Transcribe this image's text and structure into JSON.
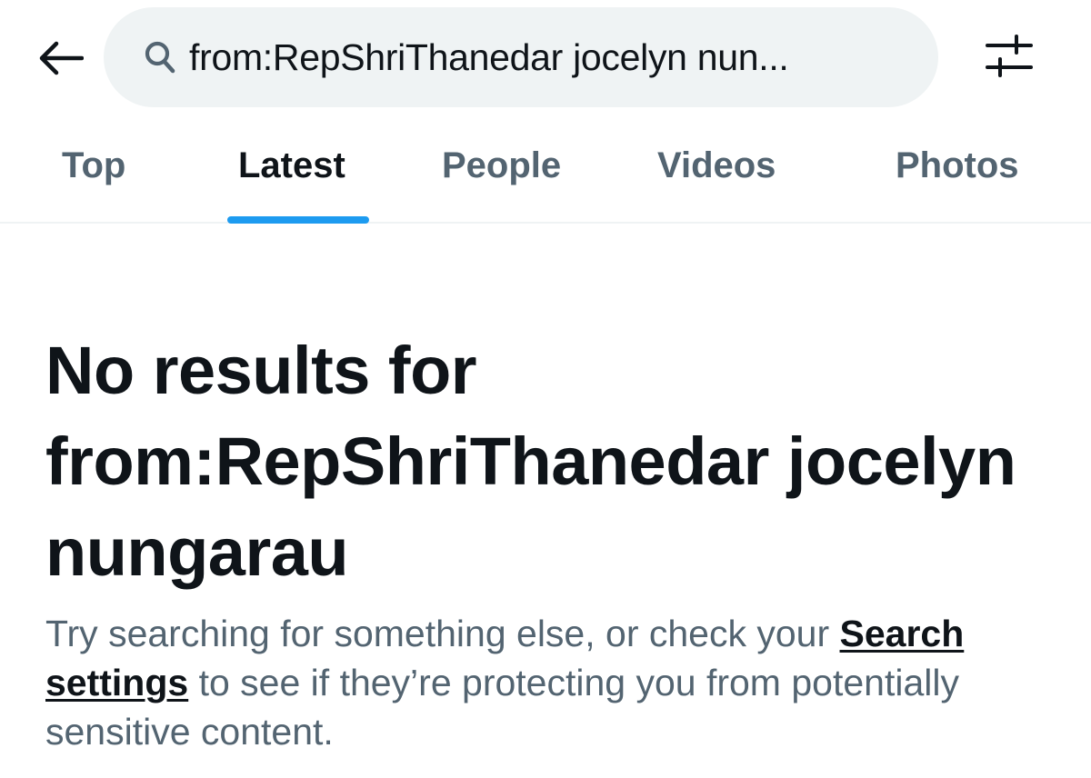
{
  "header": {
    "back_icon": "arrow-left-icon",
    "search": {
      "icon": "search-icon",
      "value": "from:RepShriThanedar jocelyn nun..."
    },
    "filter_icon": "sliders-icon"
  },
  "tabs": [
    {
      "label": "Top",
      "active": false
    },
    {
      "label": "Latest",
      "active": true
    },
    {
      "label": "People",
      "active": false
    },
    {
      "label": "Videos",
      "active": false
    },
    {
      "label": "Photos",
      "active": false
    }
  ],
  "empty_state": {
    "title": "No results for from:RepShriThanedar jocelyn nungarau",
    "body_before": "Try searching for something else, or check your ",
    "link_label": "Search settings",
    "body_after": " to see if they’re protecting you from potentially sensitive content."
  },
  "colors": {
    "accent": "#1d9bf0",
    "text_primary": "#0f1419",
    "text_secondary": "#536471",
    "search_bg": "#eff3f4"
  }
}
